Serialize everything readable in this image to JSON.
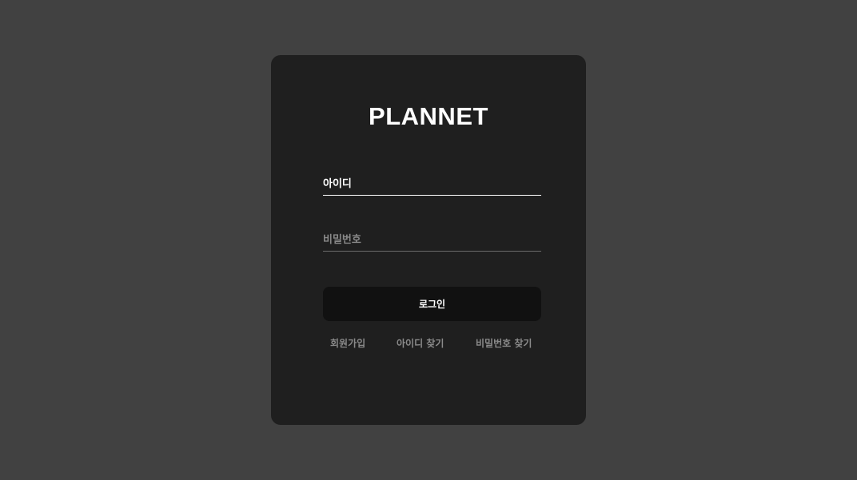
{
  "brand": {
    "title": "PLANNET"
  },
  "login_form": {
    "id_placeholder": "아이디",
    "password_placeholder": "비밀번호",
    "login_label": "로그인"
  },
  "links": {
    "signup": "회원가입",
    "find_id": "아이디 찾기",
    "find_password": "비밀번호 찾기"
  },
  "colors": {
    "background": "#414141",
    "card": "#1f1f1f",
    "button": "#111111",
    "link": "#8a8a8a"
  }
}
